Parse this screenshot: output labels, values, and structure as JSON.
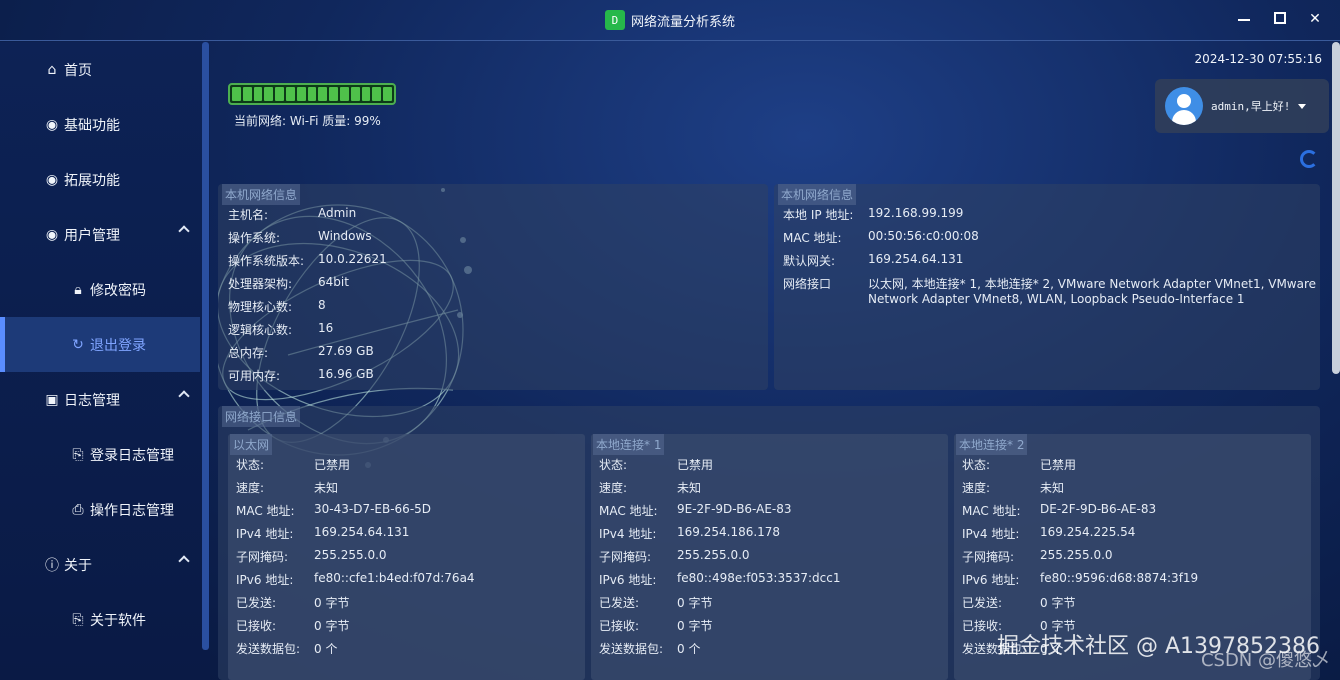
{
  "window": {
    "title": "网络流量分析系统",
    "icon_letter": "D"
  },
  "sidebar": {
    "items": [
      {
        "label": "首页",
        "icon": "home-icon"
      },
      {
        "label": "基础功能",
        "icon": "user-circle-icon"
      },
      {
        "label": "拓展功能",
        "icon": "user-circle-icon"
      },
      {
        "label": "用户管理",
        "icon": "user-circle-icon"
      },
      {
        "label": "修改密码",
        "icon": "lock-icon"
      },
      {
        "label": "退出登录",
        "icon": "logout-icon"
      },
      {
        "label": "日志管理",
        "icon": "search-doc-icon"
      },
      {
        "label": "登录日志管理",
        "icon": "doc-login-icon"
      },
      {
        "label": "操作日志管理",
        "icon": "doc-gear-icon"
      },
      {
        "label": "关于",
        "icon": "info-icon"
      },
      {
        "label": "关于软件",
        "icon": "doc-login-icon"
      }
    ]
  },
  "header": {
    "datetime": "2024-12-30 07:55:16",
    "network_status": "当前网络: Wi-Fi 质量: 99%",
    "signal_bars": 15,
    "signal_quality": 0.99,
    "user_greeting": "admin,早上好!"
  },
  "local_info": {
    "title": "本机网络信息",
    "rows": [
      {
        "k": "主机名:",
        "v": "Admin"
      },
      {
        "k": "操作系统:",
        "v": "Windows"
      },
      {
        "k": "操作系统版本:",
        "v": "10.0.22621"
      },
      {
        "k": "处理器架构:",
        "v": "64bit"
      },
      {
        "k": "物理核心数:",
        "v": "8"
      },
      {
        "k": "逻辑核心数:",
        "v": "16"
      },
      {
        "k": "总内存:",
        "v": "27.69 GB"
      },
      {
        "k": "可用内存:",
        "v": "16.96 GB"
      }
    ]
  },
  "net_info": {
    "title": "本机网络信息",
    "rows": [
      {
        "k": "本地 IP 地址:",
        "v": "192.168.99.199"
      },
      {
        "k": "MAC 地址:",
        "v": "00:50:56:c0:00:08"
      },
      {
        "k": "默认网关:",
        "v": "169.254.64.131"
      },
      {
        "k": "网络接口",
        "v": "以太网, 本地连接* 1, 本地连接* 2, VMware Network Adapter VMnet1, VMware"
      },
      {
        "k": "",
        "v": "Network Adapter VMnet8, WLAN, Loopback Pseudo-Interface 1"
      }
    ]
  },
  "interfaces": {
    "title": "网络接口信息",
    "cards": [
      {
        "name": "以太网",
        "rows": [
          {
            "k": "状态:",
            "v": "已禁用"
          },
          {
            "k": "速度:",
            "v": "未知"
          },
          {
            "k": "MAC 地址:",
            "v": "30-43-D7-EB-66-5D"
          },
          {
            "k": "IPv4 地址:",
            "v": "169.254.64.131"
          },
          {
            "k": "子网掩码:",
            "v": "255.255.0.0"
          },
          {
            "k": "IPv6 地址:",
            "v": "fe80::cfe1:b4ed:f07d:76a4"
          },
          {
            "k": "已发送:",
            "v": "0 字节"
          },
          {
            "k": "已接收:",
            "v": "0 字节"
          },
          {
            "k": "发送数据包:",
            "v": "0 个"
          }
        ]
      },
      {
        "name": "本地连接* 1",
        "rows": [
          {
            "k": "状态:",
            "v": "已禁用"
          },
          {
            "k": "速度:",
            "v": "未知"
          },
          {
            "k": "MAC 地址:",
            "v": "9E-2F-9D-B6-AE-83"
          },
          {
            "k": "IPv4 地址:",
            "v": "169.254.186.178"
          },
          {
            "k": "子网掩码:",
            "v": "255.255.0.0"
          },
          {
            "k": "IPv6 地址:",
            "v": "fe80::498e:f053:3537:dcc1"
          },
          {
            "k": "已发送:",
            "v": "0 字节"
          },
          {
            "k": "已接收:",
            "v": "0 字节"
          },
          {
            "k": "发送数据包:",
            "v": "0 个"
          }
        ]
      },
      {
        "name": "本地连接* 2",
        "rows": [
          {
            "k": "状态:",
            "v": "已禁用"
          },
          {
            "k": "速度:",
            "v": "未知"
          },
          {
            "k": "MAC 地址:",
            "v": "DE-2F-9D-B6-AE-83"
          },
          {
            "k": "IPv4 地址:",
            "v": "169.254.225.54"
          },
          {
            "k": "子网掩码:",
            "v": "255.255.0.0"
          },
          {
            "k": "IPv6 地址:",
            "v": "fe80::9596:d68:8874:3f19"
          },
          {
            "k": "已发送:",
            "v": "0 字节"
          },
          {
            "k": "已接收:",
            "v": "0 字节"
          },
          {
            "k": "发送数据包:",
            "v": "0 个"
          }
        ]
      }
    ]
  },
  "watermark": {
    "line1": "掘金技术社区 @ A1397852386",
    "line2": "CSDN @傻悠乄"
  }
}
